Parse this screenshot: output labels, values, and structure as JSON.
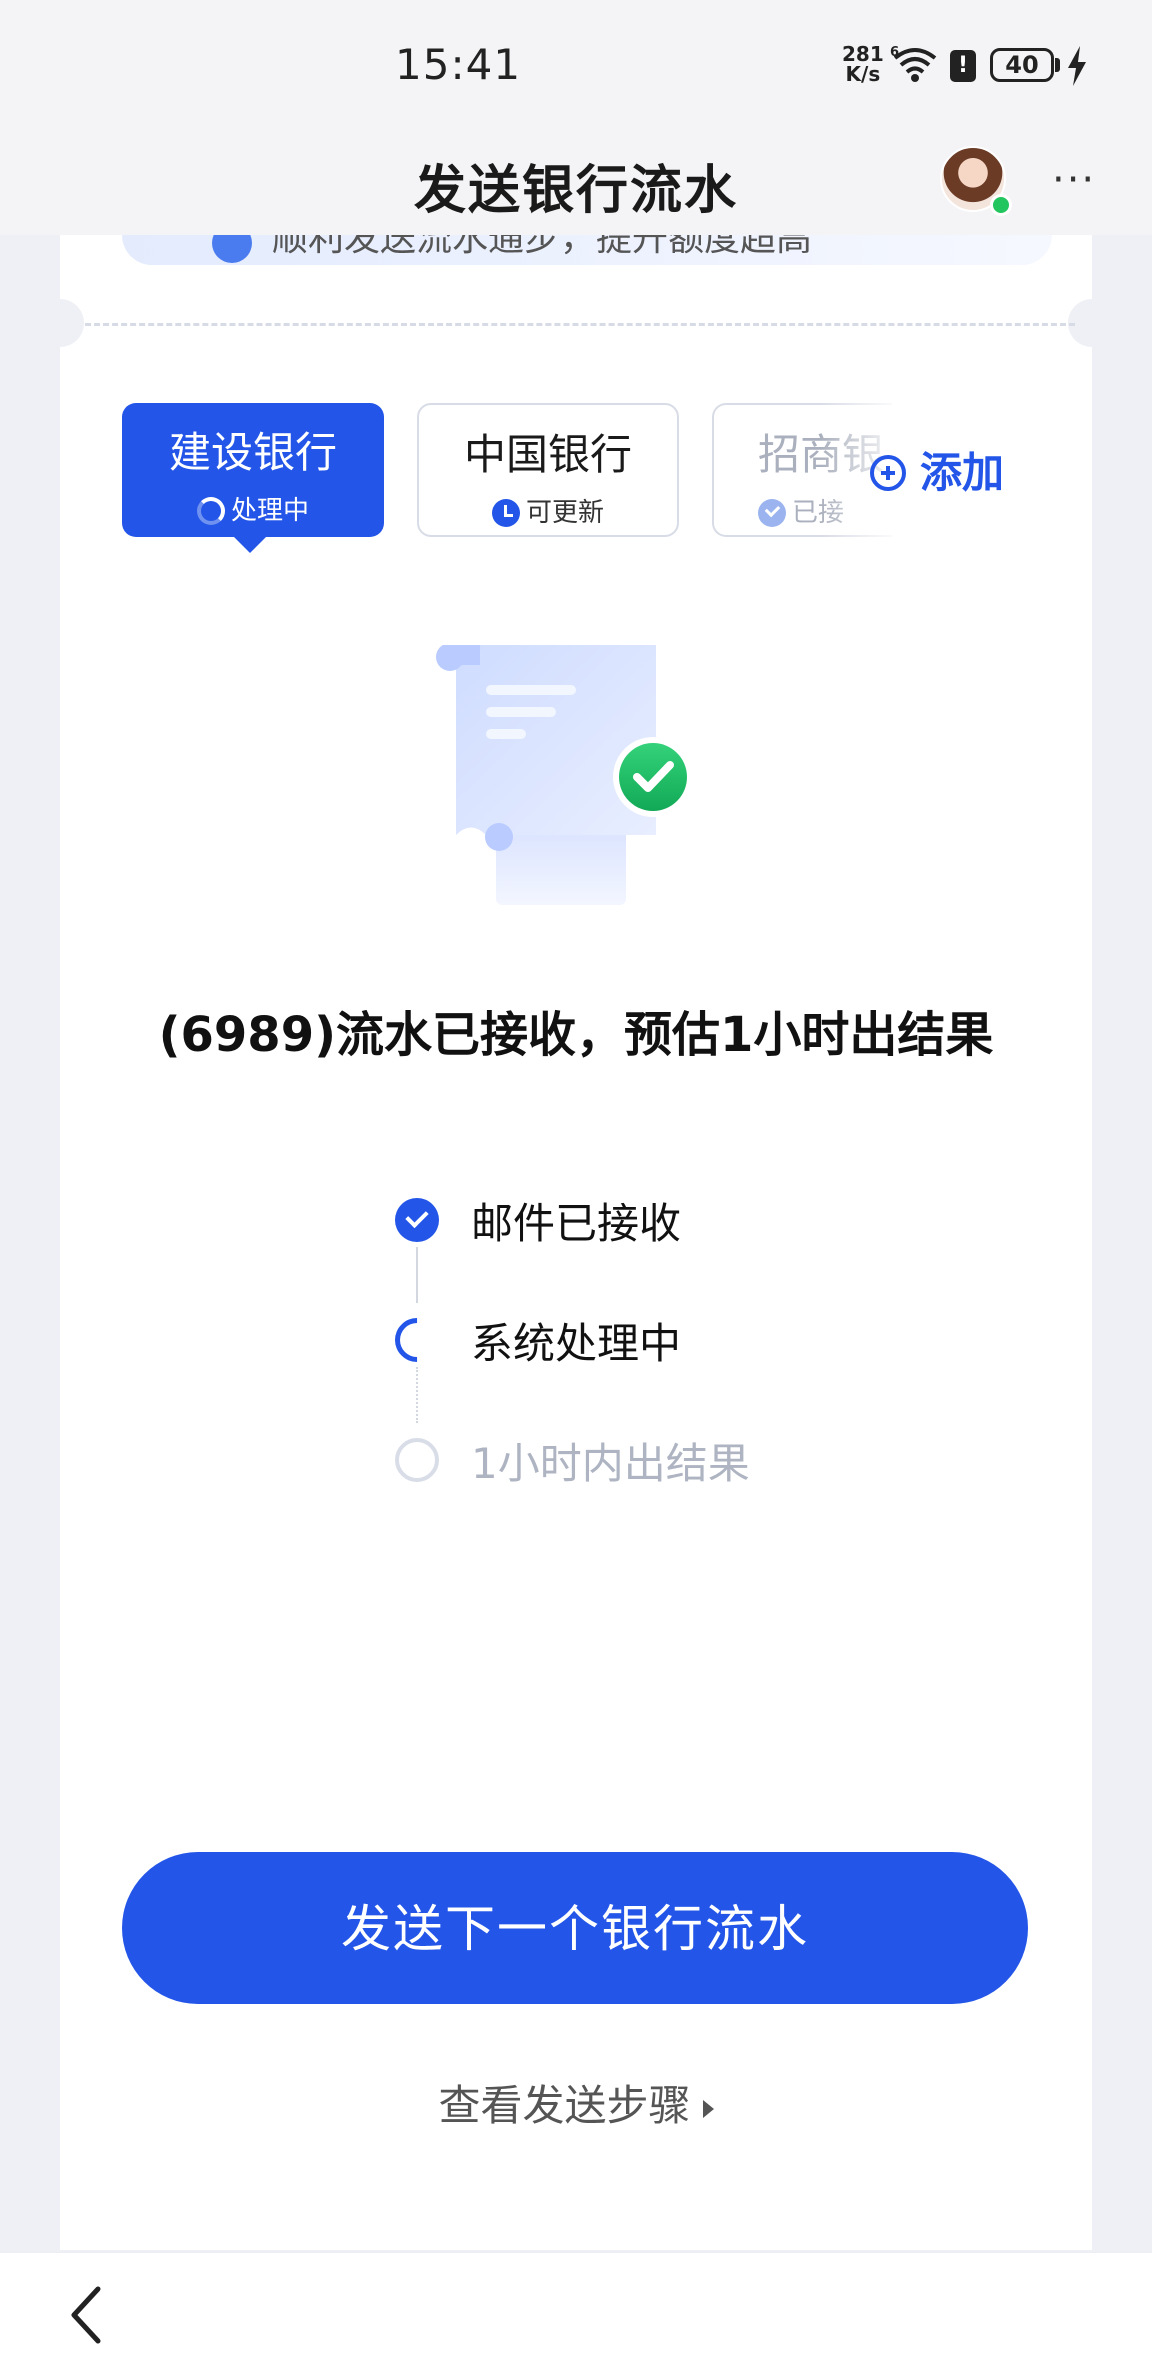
{
  "status_bar": {
    "time": "15:41",
    "net_speed_value": "281",
    "net_speed_unit": "K/s",
    "wifi_label": "6",
    "battery": "40"
  },
  "header": {
    "title": "发送银行流水"
  },
  "tip": {
    "text": "顺利发送流水通步，提升额度超高"
  },
  "bank_tabs": [
    {
      "name": "建设银行",
      "status": "处理中",
      "selected": true
    },
    {
      "name": "中国银行",
      "status": "可更新",
      "selected": false
    },
    {
      "name": "招商银",
      "status": "已接",
      "selected": false
    }
  ],
  "add_label": "添加",
  "result": {
    "text": "(6989)流水已接收，预估1小时出结果"
  },
  "steps": [
    {
      "label": "邮件已接收",
      "state": "done"
    },
    {
      "label": "系统处理中",
      "state": "active"
    },
    {
      "label": "1小时内出结果",
      "state": "pending"
    }
  ],
  "actions": {
    "primary": "发送下一个银行流水",
    "secondary": "查看发送步骤"
  },
  "colors": {
    "accent": "#2356e8",
    "success": "#22c55e",
    "background": "#eef0f6"
  }
}
